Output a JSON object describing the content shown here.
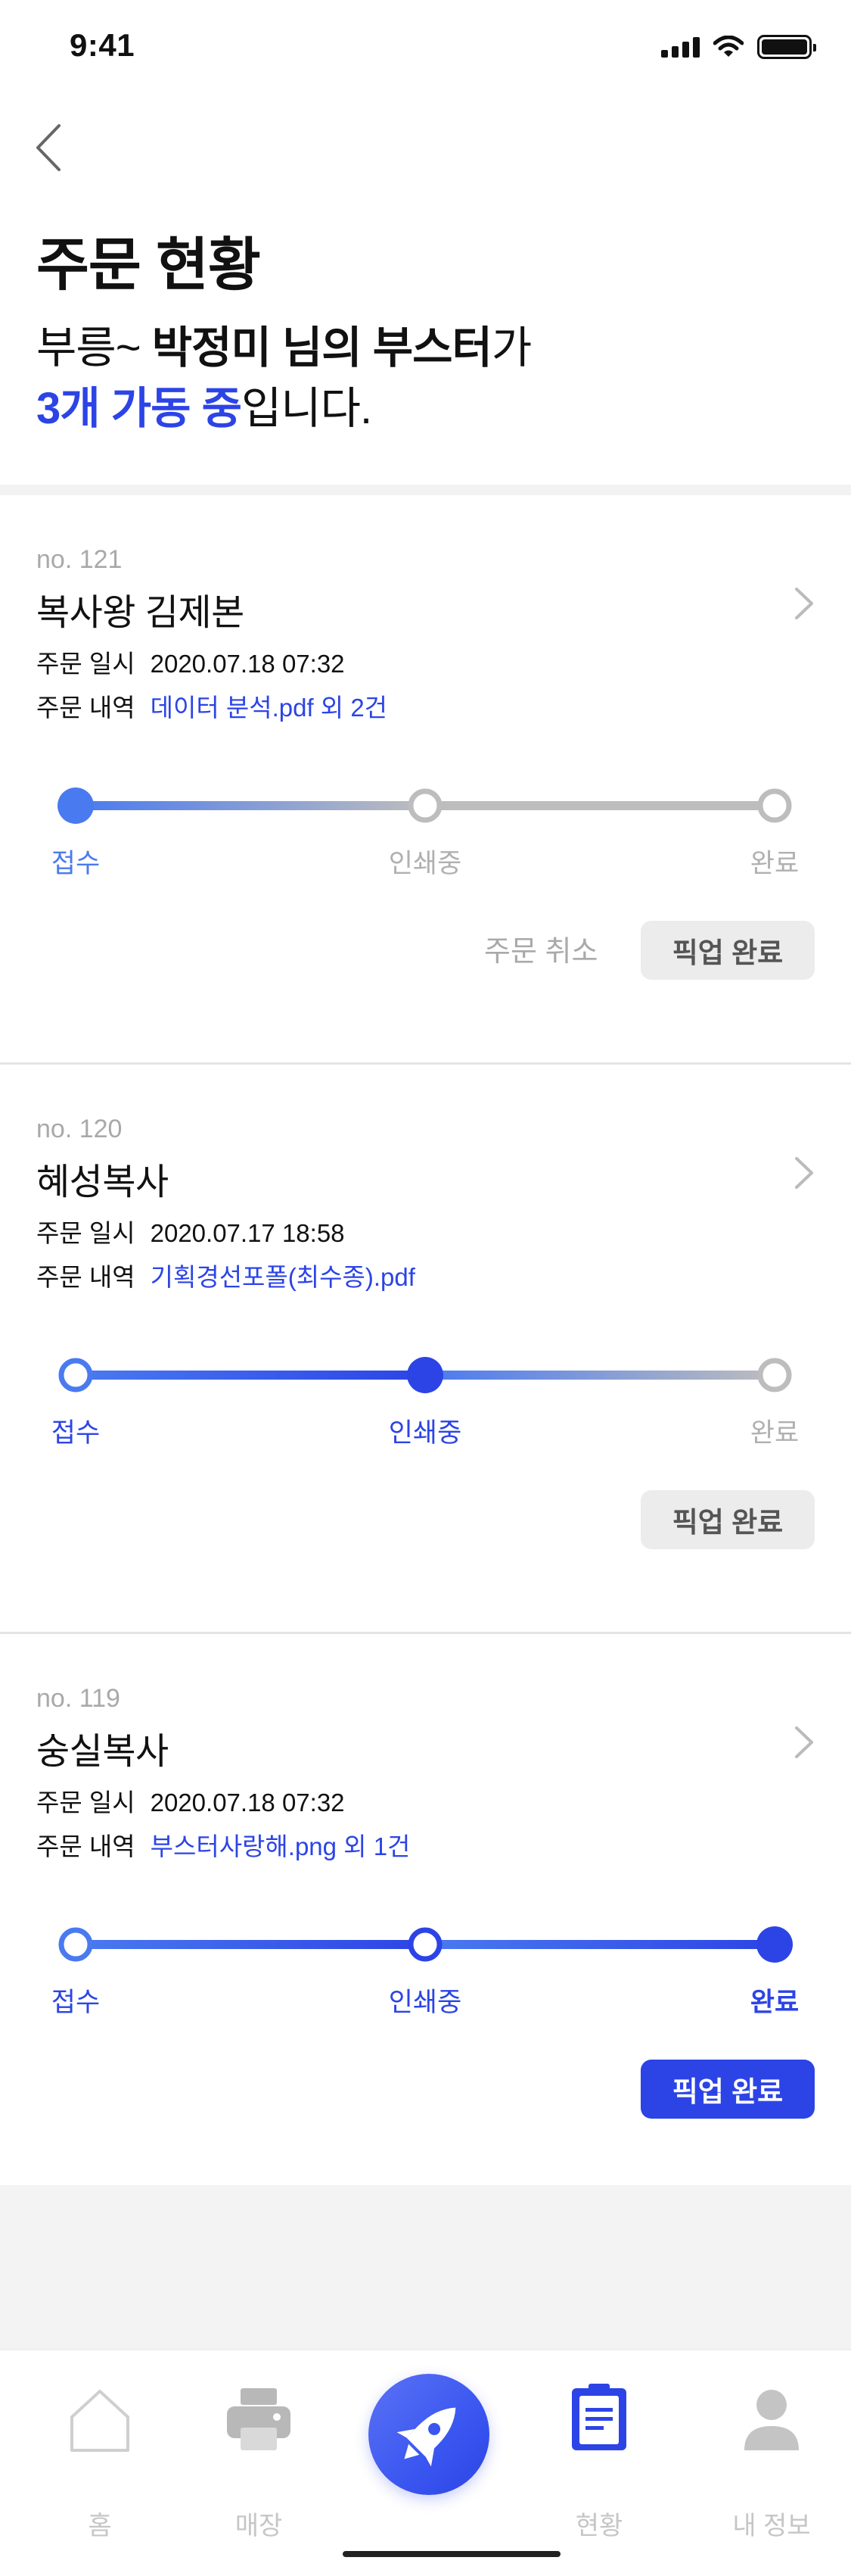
{
  "status_bar": {
    "time": "9:41"
  },
  "header": {
    "title": "주문 현황",
    "greeting": {
      "prefix": "부릉~ ",
      "name": "박정미 님의 부스터",
      "suffix": "가",
      "count": "3개 가동 중",
      "end": "입니다."
    }
  },
  "orders": [
    {
      "number": "no. 121",
      "store": "복사왕 김제본",
      "date_label": "주문 일시",
      "date": "2020.07.18 07:32",
      "detail_label": "주문 내역",
      "files": "데이터 분석.pdf 외 2건",
      "steps": [
        "접수",
        "인쇄중",
        "완료"
      ],
      "current_step": 0,
      "cancel_label": "주문 취소",
      "pickup_label": "픽업 완료",
      "pickup_enabled": false
    },
    {
      "number": "no. 120",
      "store": "혜성복사",
      "date_label": "주문 일시",
      "date": "2020.07.17 18:58",
      "detail_label": "주문 내역",
      "files": "기획경선포폴(최수종).pdf",
      "steps": [
        "접수",
        "인쇄중",
        "완료"
      ],
      "current_step": 1,
      "pickup_label": "픽업 완료",
      "pickup_enabled": false
    },
    {
      "number": "no. 119",
      "store": "숭실복사",
      "date_label": "주문 일시",
      "date": "2020.07.18 07:32",
      "detail_label": "주문 내역",
      "files": "부스터사랑해.png 외 1건",
      "steps": [
        "접수",
        "인쇄중",
        "완료"
      ],
      "current_step": 2,
      "pickup_label": "픽업 완료",
      "pickup_enabled": true
    }
  ],
  "tab_bar": {
    "items": [
      {
        "label": "홈",
        "icon": "home-icon",
        "active": false
      },
      {
        "label": "매장",
        "icon": "printer-icon",
        "active": false
      },
      {
        "label": "",
        "icon": "rocket-icon",
        "active": false
      },
      {
        "label": "현황",
        "icon": "clipboard-icon",
        "active": true
      },
      {
        "label": "내 정보",
        "icon": "person-icon",
        "active": false
      }
    ]
  },
  "colors": {
    "accent": "#2c44e6",
    "accent_light": "#4a7af0",
    "inactive": "#bdbdbd",
    "muted_text": "#a9a9a9"
  }
}
